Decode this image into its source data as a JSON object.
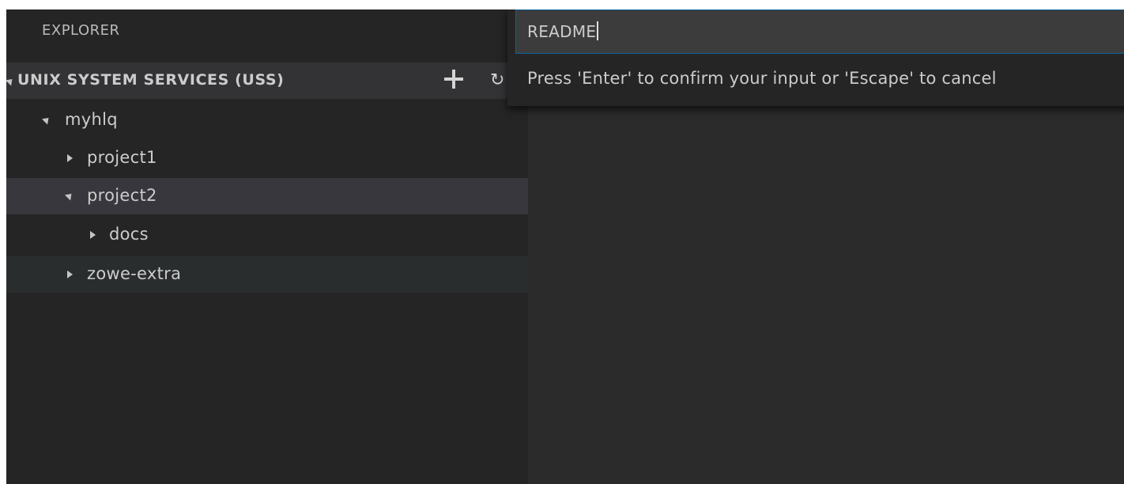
{
  "sidebar": {
    "title": "EXPLORER",
    "section": {
      "label": "UNIX SYSTEM SERVICES (USS)",
      "add_icon": "plus-icon",
      "refresh_icon": "refresh-icon"
    },
    "tree": [
      {
        "label": "myhlq",
        "expanded": true
      },
      {
        "label": "project1",
        "expanded": false
      },
      {
        "label": "project2",
        "expanded": true
      },
      {
        "label": "docs",
        "expanded": false
      },
      {
        "label": "zowe-extra",
        "expanded": false
      }
    ]
  },
  "quick_input": {
    "value": "README",
    "message": "Press 'Enter' to confirm your input or 'Escape' to cancel"
  },
  "colors": {
    "sidebar_bg": "#252526",
    "editor_bg": "#2b2b2b",
    "focus_border": "#0e639c",
    "selected_row": "#37373d"
  }
}
